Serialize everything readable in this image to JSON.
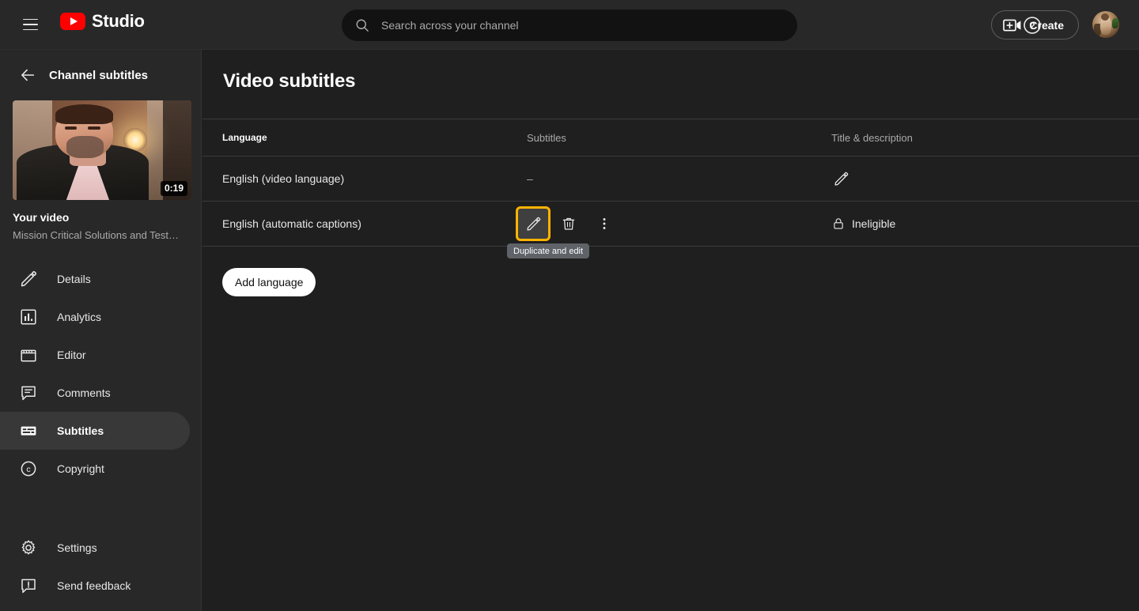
{
  "topbar": {
    "menu_icon": "hamburger-menu-icon",
    "brand": "Studio",
    "logo_icon": "youtube-logo-icon",
    "search": {
      "placeholder": "Search across your channel",
      "value": "",
      "icon": "search-icon"
    },
    "help_icon": "help-question-mark-icon",
    "create_label": "Create",
    "create_icon": "video-plus-icon",
    "avatar": "channel-avatar"
  },
  "sidebar": {
    "back_icon": "back-arrow-icon",
    "header_title": "Channel subtitles",
    "video": {
      "duration": "0:19",
      "title": "Your video",
      "description": "Mission Critical Solutions and TestR…"
    },
    "items": [
      {
        "label": "Details",
        "icon": "pencil-icon",
        "active": false
      },
      {
        "label": "Analytics",
        "icon": "bar-chart-icon",
        "active": false
      },
      {
        "label": "Editor",
        "icon": "clapperboard-icon",
        "active": false
      },
      {
        "label": "Comments",
        "icon": "comment-icon",
        "active": false
      },
      {
        "label": "Subtitles",
        "icon": "subtitles-icon",
        "active": true
      },
      {
        "label": "Copyright",
        "icon": "copyright-icon",
        "active": false
      }
    ],
    "bottom_items": [
      {
        "label": "Settings",
        "icon": "gear-icon"
      },
      {
        "label": "Send feedback",
        "icon": "feedback-icon"
      }
    ]
  },
  "main": {
    "page_title": "Video subtitles",
    "columns": {
      "language": "Language",
      "subtitles": "Subtitles",
      "title_description": "Title & description"
    },
    "rows": [
      {
        "language": "English (video language)",
        "subtitles_text": "–",
        "title_status": "",
        "edit_icon": "pencil-icon"
      },
      {
        "language": "English (automatic captions)",
        "subtitles_text": "",
        "title_status": "Ineligible",
        "status_icon": "lock-icon",
        "actions": [
          {
            "icon": "pencil-icon",
            "name": "duplicate-and-edit-button",
            "highlighted": true
          },
          {
            "icon": "trash-icon",
            "name": "delete-button",
            "highlighted": false
          },
          {
            "icon": "more-vertical-icon",
            "name": "more-options-button",
            "highlighted": false
          }
        ]
      }
    ],
    "tooltip": "Duplicate and edit",
    "add_language_label": "Add language"
  },
  "colors": {
    "highlight": "#ffb300",
    "brand_red": "#ff0000",
    "topbar_bg": "#282828",
    "content_bg": "#1f1f1f",
    "tooltip_bg": "#5f6368"
  }
}
